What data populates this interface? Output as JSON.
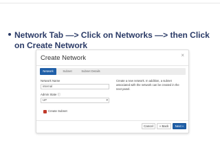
{
  "slide": {
    "bullet_line1": "Network Tab —> Click on Networks —> then Click",
    "bullet_line2": "on Create Network"
  },
  "modal": {
    "title": "Create Network",
    "close_glyph": "×",
    "tabs": [
      {
        "label": "Network",
        "active": true
      },
      {
        "label": "Subnet",
        "active": false
      },
      {
        "label": "Subnet Details",
        "active": false
      }
    ],
    "network_name_label": "Network Name",
    "network_name_value": "internal",
    "admin_state_label": "Admin State ⓘ",
    "admin_state_value": "UP",
    "create_subnet_label": "Create Subnet",
    "help_text": "Create a new network. In addition, a subnet associated with the network can be created in the next panel.",
    "buttons": {
      "cancel": "Cancel",
      "back": "« Back",
      "next": "Next »"
    }
  },
  "colors": {
    "accent": "#1f5fa8",
    "bullet_text": "#2a3a66",
    "checkbox": "#c0392b"
  }
}
